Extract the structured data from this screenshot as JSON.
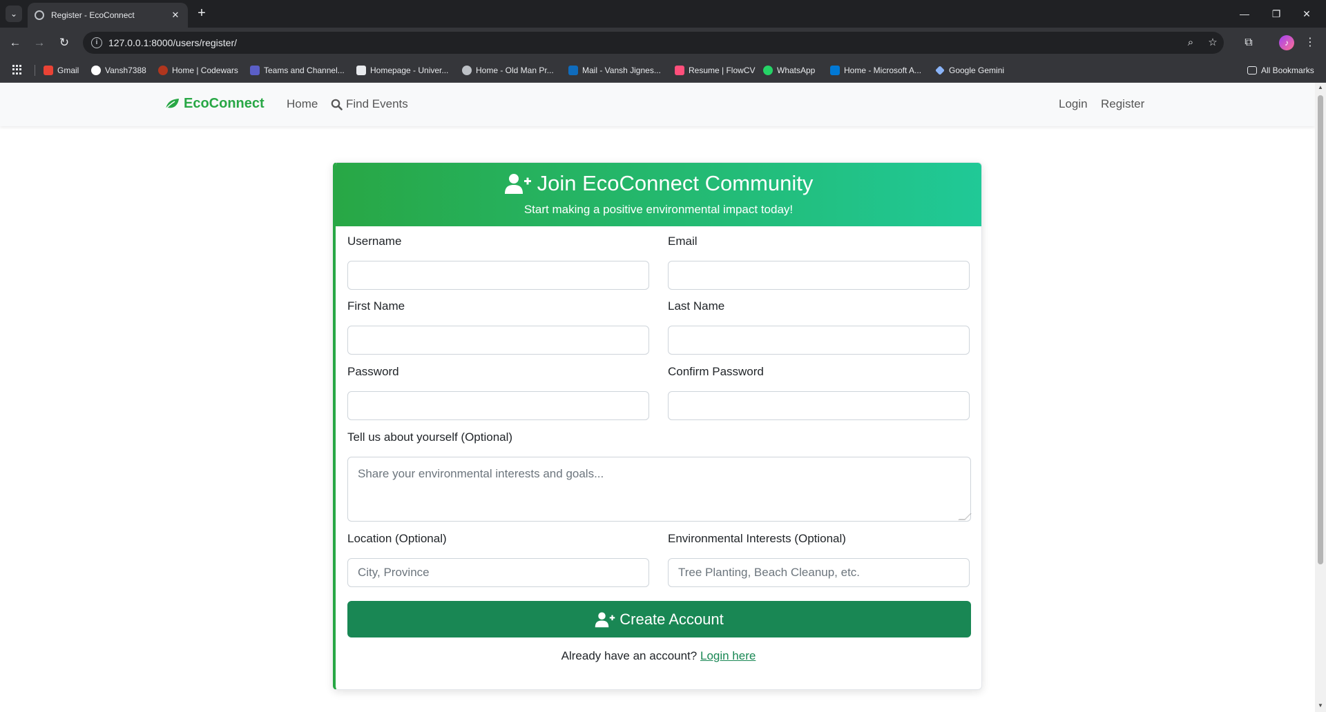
{
  "browser": {
    "tab_title": "Register - EcoConnect",
    "tab_close": "✕",
    "new_tab": "+",
    "url": "127.0.0.1:8000/users/register/",
    "window_controls": [
      "—",
      "❐",
      "✕"
    ],
    "bookmarks": [
      {
        "label": "Gmail",
        "icon": "gmail-icon",
        "color": "#ea4335"
      },
      {
        "label": "Vansh7388",
        "icon": "github-icon",
        "color": "#ffffff"
      },
      {
        "label": "Home | Codewars",
        "icon": "codewars-icon",
        "color": "#b1361e"
      },
      {
        "label": "Teams and Channel...",
        "icon": "teams-icon",
        "color": "#5b5fc7"
      },
      {
        "label": "Homepage - Univer...",
        "icon": "w-icon",
        "color": "#ffffff"
      },
      {
        "label": "Home - Old Man Pr...",
        "icon": "globe-icon",
        "color": "#bdc1c6"
      },
      {
        "label": "Mail - Vansh Jignes...",
        "icon": "outlook-icon",
        "color": "#0f6cbd"
      },
      {
        "label": "Resume | FlowCV",
        "icon": "flowcv-icon",
        "color": "#ff4f7b"
      },
      {
        "label": "WhatsApp",
        "icon": "whatsapp-icon",
        "color": "#25d366"
      },
      {
        "label": "Home - Microsoft A...",
        "icon": "azure-icon",
        "color": "#0078d4"
      },
      {
        "label": "Google Gemini",
        "icon": "gemini-icon",
        "color": "#8ab4f8"
      }
    ],
    "all_bookmarks": "All Bookmarks"
  },
  "nav": {
    "brand": "EcoConnect",
    "home": "Home",
    "find_events": "Find Events",
    "login": "Login",
    "register": "Register"
  },
  "card": {
    "title": "Join EcoConnect Community",
    "subtitle": "Start making a positive environmental impact today!"
  },
  "form": {
    "username_label": "Username",
    "email_label": "Email",
    "first_name_label": "First Name",
    "last_name_label": "Last Name",
    "password_label": "Password",
    "confirm_password_label": "Confirm Password",
    "bio_label": "Tell us about yourself (Optional)",
    "bio_placeholder": "Share your environmental interests and goals...",
    "location_label": "Location (Optional)",
    "location_placeholder": "City, Province",
    "interests_label": "Environmental Interests (Optional)",
    "interests_placeholder": "Tree Planting, Beach Cleanup, etc.",
    "submit_label": "Create Account",
    "already_text": "Already have an account?",
    "login_link": "Login here"
  },
  "colors": {
    "brand_green": "#28a745",
    "button_green": "#198754",
    "header_gradient_end": "#20c997"
  }
}
